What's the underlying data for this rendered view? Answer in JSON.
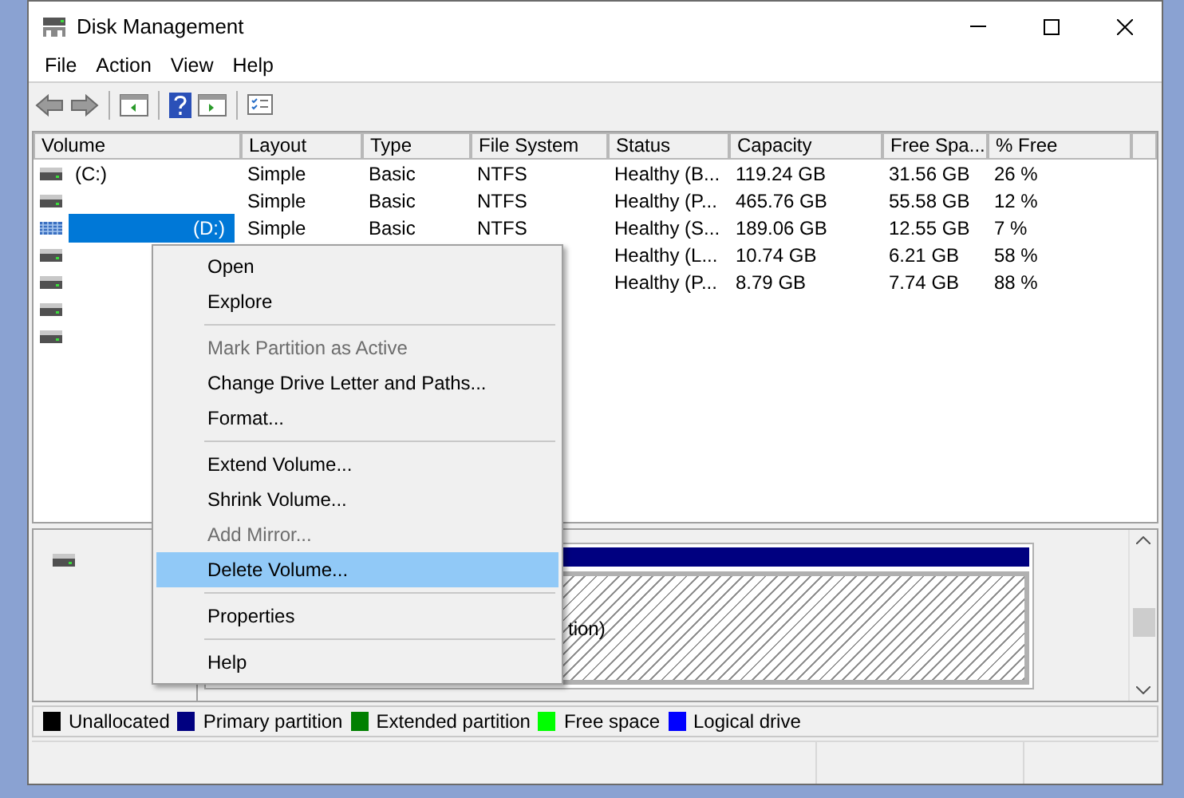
{
  "window": {
    "title": "Disk Management"
  },
  "menu_bar": [
    "File",
    "Action",
    "View",
    "Help"
  ],
  "table": {
    "columns": [
      "Volume",
      "Layout",
      "Type",
      "File System",
      "Status",
      "Capacity",
      "Free Spa...",
      "% Free"
    ],
    "rows": [
      {
        "volume": "(C:)",
        "layout": "Simple",
        "type": "Basic",
        "file_system": "NTFS",
        "status": "Healthy (B...",
        "capacity": "119.24 GB",
        "free_space": "31.56 GB",
        "percent_free": "26 %",
        "selected": false
      },
      {
        "layout": "Simple",
        "type": "Basic",
        "file_system": "NTFS",
        "status": "Healthy (P...",
        "capacity": "465.76 GB",
        "free_space": "55.58 GB",
        "percent_free": "12 %",
        "selected": false
      },
      {
        "volume": "(D:)",
        "layout": "Simple",
        "type": "Basic",
        "file_system": "NTFS",
        "status": "Healthy (S...",
        "capacity": "189.06 GB",
        "free_space": "12.55 GB",
        "percent_free": "7 %",
        "selected": true
      },
      {
        "status": "Healthy (L...",
        "capacity": "10.74 GB",
        "free_space": "6.21 GB",
        "percent_free": "58 %",
        "selected": false
      },
      {
        "status": "Healthy (P...",
        "capacity": "8.79 GB",
        "free_space": "7.74 GB",
        "percent_free": "88 %",
        "selected": false
      },
      {
        "selected": false
      },
      {
        "selected": false
      }
    ]
  },
  "context_menu": [
    {
      "kind": "item",
      "label": "Open",
      "disabled": false,
      "selected": false
    },
    {
      "kind": "item",
      "label": "Explore",
      "disabled": false,
      "selected": false
    },
    {
      "kind": "separator"
    },
    {
      "kind": "item",
      "label": "Mark Partition as Active",
      "disabled": true,
      "selected": false
    },
    {
      "kind": "item",
      "label": "Change Drive Letter and Paths...",
      "disabled": false,
      "selected": false
    },
    {
      "kind": "item",
      "label": "Format...",
      "disabled": false,
      "selected": false
    },
    {
      "kind": "separator"
    },
    {
      "kind": "item",
      "label": "Extend Volume...",
      "disabled": false,
      "selected": false
    },
    {
      "kind": "item",
      "label": "Shrink Volume...",
      "disabled": false,
      "selected": false
    },
    {
      "kind": "item",
      "label": "Add Mirror...",
      "disabled": true,
      "selected": false
    },
    {
      "kind": "item",
      "label": "Delete Volume...",
      "disabled": false,
      "selected": true
    },
    {
      "kind": "separator"
    },
    {
      "kind": "item",
      "label": "Properties",
      "disabled": false,
      "selected": false
    },
    {
      "kind": "separator"
    },
    {
      "kind": "item",
      "label": "Help",
      "disabled": false,
      "selected": false
    }
  ],
  "disk_map": {
    "partition_text": "tion)"
  },
  "legend": [
    {
      "label": "Unallocated",
      "color": "#000000"
    },
    {
      "label": "Primary partition",
      "color": "#000080"
    },
    {
      "label": "Extended partition",
      "color": "#008000"
    },
    {
      "label": "Free space",
      "color": "#00ff00"
    },
    {
      "label": "Logical drive",
      "color": "#0000ff"
    }
  ]
}
